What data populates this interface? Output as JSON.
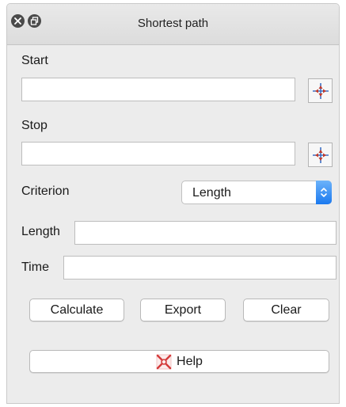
{
  "window": {
    "title": "Shortest path"
  },
  "form": {
    "start_label": "Start",
    "start_value": "",
    "stop_label": "Stop",
    "stop_value": "",
    "criterion_label": "Criterion",
    "criterion_selected": "Length",
    "length_label": "Length",
    "length_value": "",
    "time_label": "Time",
    "time_value": ""
  },
  "buttons": {
    "calculate": "Calculate",
    "export": "Export",
    "clear": "Clear",
    "help": "Help"
  },
  "icons": {
    "close": "close-icon",
    "float": "float-icon",
    "capture_point": "capture-point-icon",
    "help": "help-icon",
    "dropdown": "chevron-updown-icon"
  },
  "colors": {
    "accent": "#1b79ef",
    "capture_icon": "#c0392b",
    "capture_cross": "#3b6fc4"
  }
}
